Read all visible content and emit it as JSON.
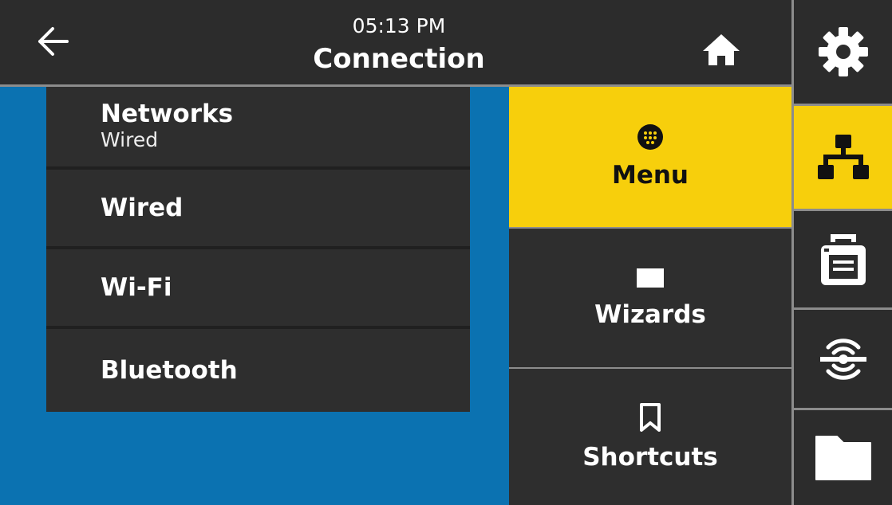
{
  "header": {
    "time": "05:13 PM",
    "title": "Connection",
    "back_icon": "back-arrow-icon",
    "home_icon": "home-icon"
  },
  "menu_list": {
    "items": [
      {
        "label": "Networks",
        "sublabel": "Wired"
      },
      {
        "label": "Wired"
      },
      {
        "label": "Wi-Fi"
      },
      {
        "label": "Bluetooth"
      }
    ]
  },
  "main_tiles": {
    "menu": {
      "label": "Menu",
      "icon": "grid-dots-icon"
    },
    "wizards": {
      "label": "Wizards",
      "icon": "book-icon"
    },
    "shortcuts": {
      "label": "Shortcuts",
      "icon": "bookmark-icon"
    }
  },
  "rail": {
    "items": [
      {
        "icon": "gear-icon"
      },
      {
        "icon": "network-icon",
        "selected": true
      },
      {
        "icon": "printer-icon"
      },
      {
        "icon": "rfid-icon"
      },
      {
        "icon": "folder-icon"
      }
    ]
  },
  "colors": {
    "accent": "#f7cf0c",
    "content_background": "#0b72b1",
    "panel": "#2e2e2e",
    "text": "#ffffff"
  }
}
